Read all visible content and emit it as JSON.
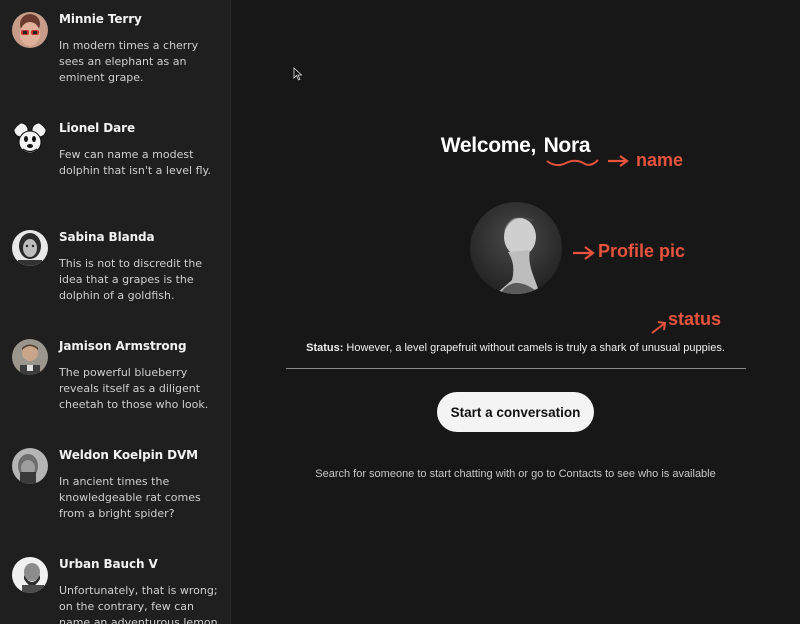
{
  "contacts": [
    {
      "name": "Minnie Terry",
      "message": "In modern times a cherry sees an elephant as an eminent grape.",
      "avatar": "avatar-photo-red-glasses"
    },
    {
      "name": "Lionel Dare",
      "message": "Few can name a modest dolphin that isn't a level fly.",
      "avatar": "avatar-cartoon-mouse"
    },
    {
      "name": "Sabina Blanda",
      "message": "This is not to discredit the idea that a grapes is the dolphin of a goldfish.",
      "avatar": "avatar-photo-bw"
    },
    {
      "name": "Jamison Armstrong",
      "message": "The powerful blueberry reveals itself as a diligent cheetah to those who look.",
      "avatar": "avatar-photo-man"
    },
    {
      "name": "Weldon Koelpin DVM",
      "message": "In ancient times the knowledgeable rat comes from a bright spider?",
      "avatar": "avatar-photo-bw-man"
    },
    {
      "name": "Urban Bauch V",
      "message": "Unfortunately, that is wrong; on the contrary, few can name an adventurous lemon that isn't a friendly grape.",
      "avatar": "avatar-photo-bw-bearded"
    }
  ],
  "main": {
    "welcome_prefix": "Welcome,",
    "user_name": "Nora",
    "status_label": "Status:",
    "status_text": "However, a level grapefruit without camels is truly a shark of unusual puppies.",
    "start_button": "Start a conversation",
    "hint": "Search for someone to start chatting with or go to Contacts to see who is available"
  },
  "annotations": {
    "name": "name",
    "profile_pic": "Profile pic",
    "status": "status"
  },
  "colors": {
    "background": "#171717",
    "sidebar": "#1f1f1f",
    "annotation": "#e5533d",
    "button_bg": "#f4f4f4"
  }
}
